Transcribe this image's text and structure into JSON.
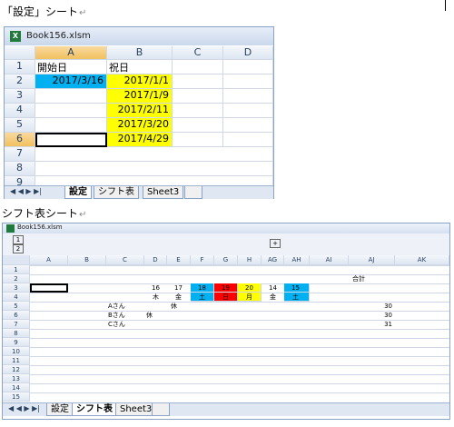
{
  "section1_title": "「設定」シート",
  "section2_title": "シフト表シート",
  "para_mark": "↵",
  "win1": {
    "title": "Book156.xlsm",
    "icon_letter": "X",
    "cols": [
      "A",
      "B",
      "C",
      "D"
    ],
    "rows": [
      "1",
      "2",
      "3",
      "4",
      "5",
      "6",
      "7",
      "8",
      "9"
    ],
    "a1": "開始日",
    "b1": "祝日",
    "a2": "2017/3/16",
    "holidays": [
      "2017/1/1",
      "2017/1/9",
      "2017/2/11",
      "2017/3/20",
      "2017/4/29"
    ],
    "tabs": [
      "設定",
      "シフト表",
      "Sheet3"
    ],
    "nav": "◀ ◀ ▶ ▶|"
  },
  "win2": {
    "title": "Book156.xlsm",
    "group_buttons": [
      "1",
      "2"
    ],
    "expand_button": "+",
    "cols": [
      "A",
      "B",
      "C",
      "D",
      "E",
      "F",
      "G",
      "H",
      "AG",
      "AH",
      "AI",
      "AJ",
      "AK"
    ],
    "rows": [
      "1",
      "2",
      "3",
      "4",
      "5",
      "6",
      "7",
      "8",
      "9",
      "10",
      "11",
      "12",
      "13",
      "14",
      "15"
    ],
    "total_label": "合計",
    "dates": [
      "16",
      "17",
      "18",
      "19",
      "20",
      "14",
      "15"
    ],
    "weekdays": [
      "木",
      "金",
      "土",
      "日",
      "月",
      "金",
      "土"
    ],
    "people": [
      {
        "name": "Aさん",
        "d": "",
        "e": "休",
        "total": "30"
      },
      {
        "name": "Bさん",
        "d": "休",
        "e": "",
        "total": "30"
      },
      {
        "name": "Cさん",
        "d": "",
        "e": "",
        "total": "31"
      }
    ],
    "tabs": [
      "設定",
      "シフト表",
      "Sheet3"
    ],
    "nav": "◀ ◀ ▶ ▶|"
  },
  "colors": {
    "yellow": "#ffff00",
    "blue": "#00b0f0",
    "red": "#ff0000"
  }
}
